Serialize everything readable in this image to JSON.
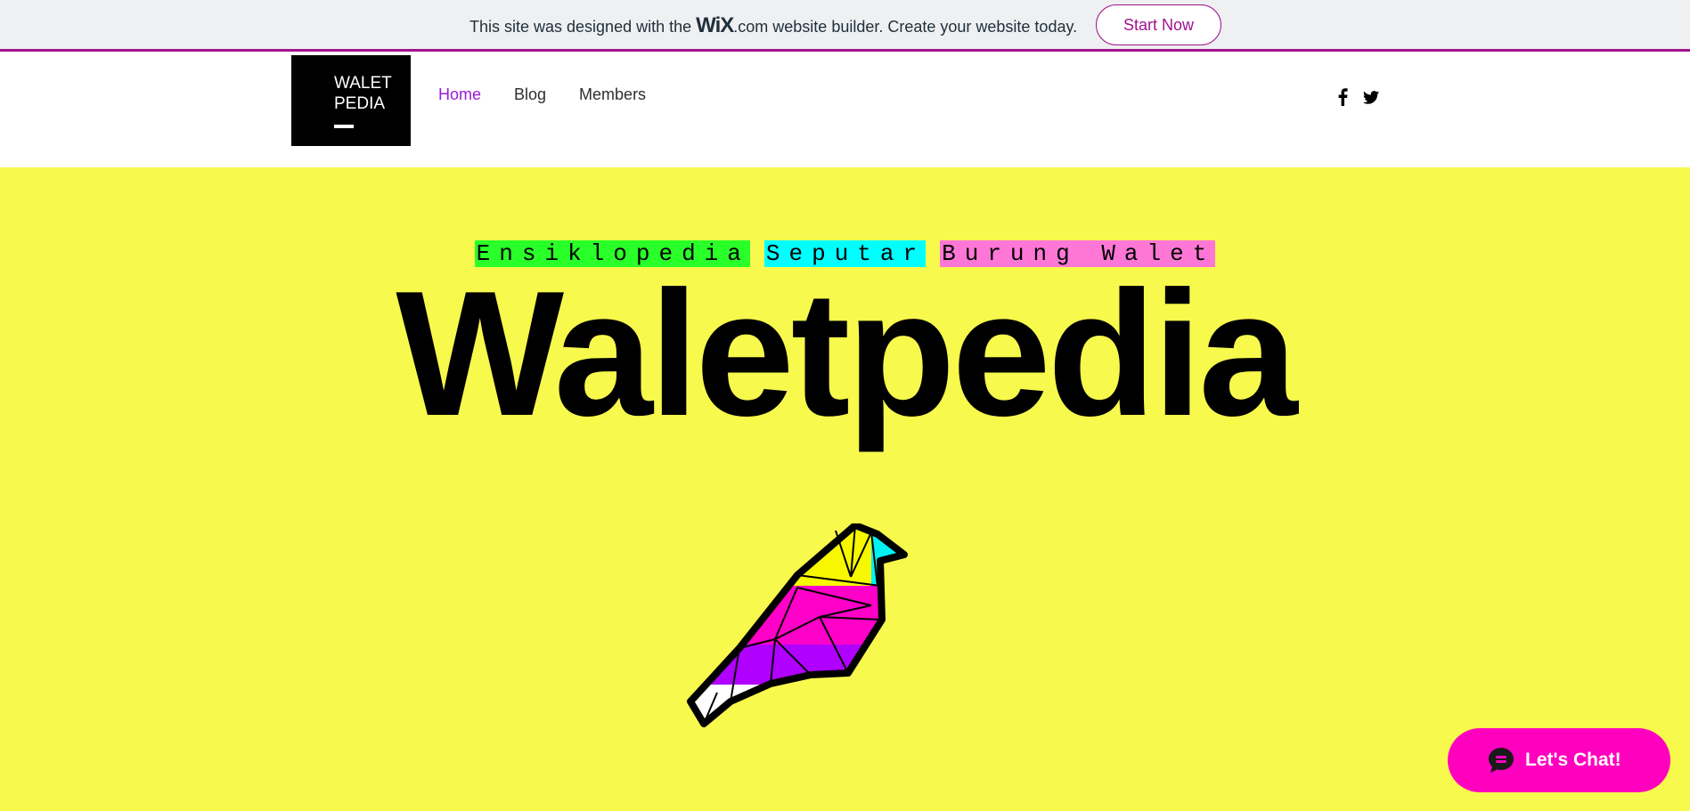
{
  "wix_banner": {
    "text_before": "This site was designed with the ",
    "wix_logo": "WiX",
    "dotcom": ".com",
    "text_after": " website builder. Create your website today.",
    "cta_label": "Start Now",
    "accent_color": "#a0138e"
  },
  "header": {
    "logo_text": "WALET\nPEDIA",
    "nav": [
      {
        "label": "Home",
        "active": true
      },
      {
        "label": "Blog",
        "active": false
      },
      {
        "label": "Members",
        "active": false
      }
    ],
    "social_icons": [
      "facebook-icon",
      "twitter-icon"
    ]
  },
  "hero": {
    "background": "#f8f94d",
    "tags": [
      {
        "text": "Ensiklopedia",
        "color": "#29ff29"
      },
      {
        "text": "Seputar",
        "color": "#00ffff"
      },
      {
        "text": "Burung Walet",
        "color": "#ff77d6"
      }
    ],
    "title": "Waletpedia",
    "illustration": "geometric-bird-icon"
  },
  "chat": {
    "label": "Let's Chat!",
    "color": "#ff00bf"
  }
}
